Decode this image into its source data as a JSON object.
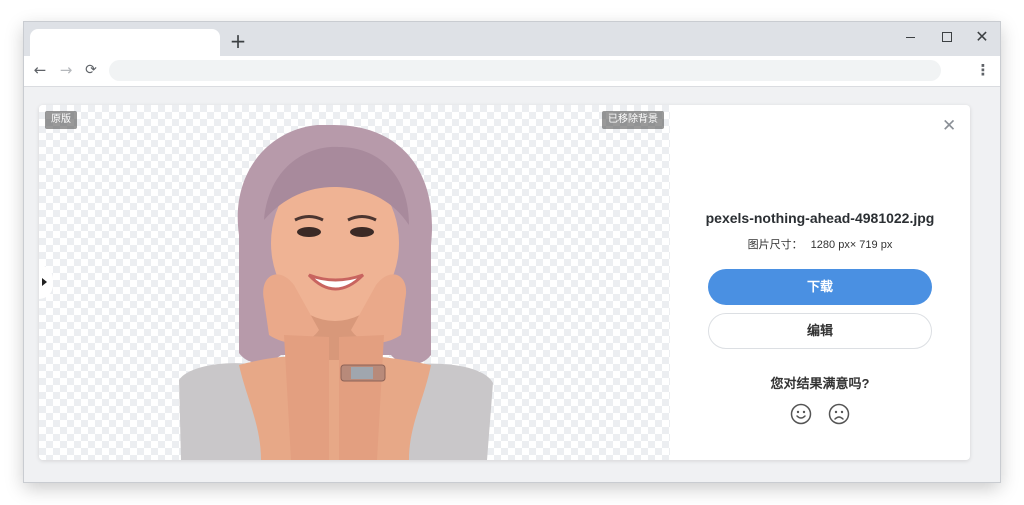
{
  "browser": {
    "new_tab_label": "+",
    "minimize_label": "",
    "maximize_label": "",
    "close_label": "✕",
    "back_label": "←",
    "forward_label": "→",
    "reload_label": "⟳",
    "menu_label": "⋮",
    "address_value": ""
  },
  "preview": {
    "badge_original": "原版",
    "badge_removed": "已移除背景"
  },
  "info": {
    "close_label": "✕",
    "filename": "pexels-nothing-ahead-4981022.jpg",
    "dims_label": "图片尺寸：",
    "dims_value": "1280 px× 719 px",
    "download_label": "下载",
    "edit_label": "编辑",
    "question": "您对结果满意吗?"
  },
  "icons": {
    "back": "arrow-left-icon",
    "forward": "arrow-right-icon",
    "reload": "reload-icon",
    "menu": "kebab-menu-icon",
    "handle": "triangle-right-icon",
    "close": "close-icon",
    "happy": "smile-face-icon",
    "sad": "sad-face-icon"
  },
  "colors": {
    "accent": "#4a90e2",
    "badge_bg": "#5a5a5a",
    "tabbar_bg": "#dee1e6"
  }
}
